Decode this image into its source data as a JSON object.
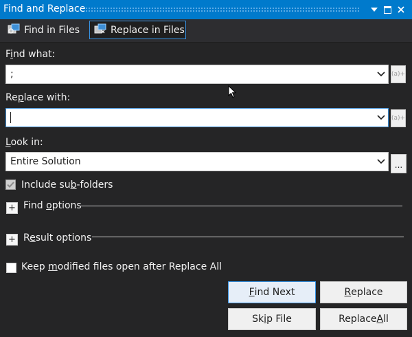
{
  "window": {
    "title": "Find and Replace"
  },
  "tabs": [
    {
      "label": "Find in Files",
      "icon": "find-in-files-icon"
    },
    {
      "label": "Replace in Files",
      "icon": "replace-in-files-icon"
    }
  ],
  "find_what": {
    "label_pre": "F",
    "label_key": "i",
    "label_post": "nd what:",
    "value": ";",
    "regex_button": "(a)+"
  },
  "replace_with": {
    "label_pre": "Re",
    "label_key": "p",
    "label_post": "lace with:",
    "value": "",
    "regex_button": "(a)+"
  },
  "look_in": {
    "label_pre": "",
    "label_key": "L",
    "label_post": "ook in:",
    "value": "Entire Solution",
    "browse_button": "..."
  },
  "include_subfolders": {
    "label_pre": "Include su",
    "label_key": "b",
    "label_post": "-folders",
    "checked": true
  },
  "find_options": {
    "label_pre": "Find ",
    "label_key": "o",
    "label_post": "ptions",
    "expander": "+"
  },
  "result_options": {
    "label_pre": "R",
    "label_key": "e",
    "label_post": "sult options",
    "expander": "+"
  },
  "keep_open": {
    "label_pre": "Keep ",
    "label_key": "m",
    "label_post": "odified files open after Replace All",
    "checked": false
  },
  "buttons": {
    "find_next": {
      "pre": "",
      "key": "F",
      "post": "ind Next"
    },
    "replace": {
      "pre": "",
      "key": "R",
      "post": "eplace"
    },
    "skip_file": {
      "pre": "Sk",
      "key": "i",
      "post": "p File"
    },
    "replace_all": {
      "pre": "Replace ",
      "key": "A",
      "post": "ll"
    }
  },
  "colors": {
    "title_bar": "#007acc",
    "background": "#252526",
    "focus_border": "#3794e6"
  }
}
